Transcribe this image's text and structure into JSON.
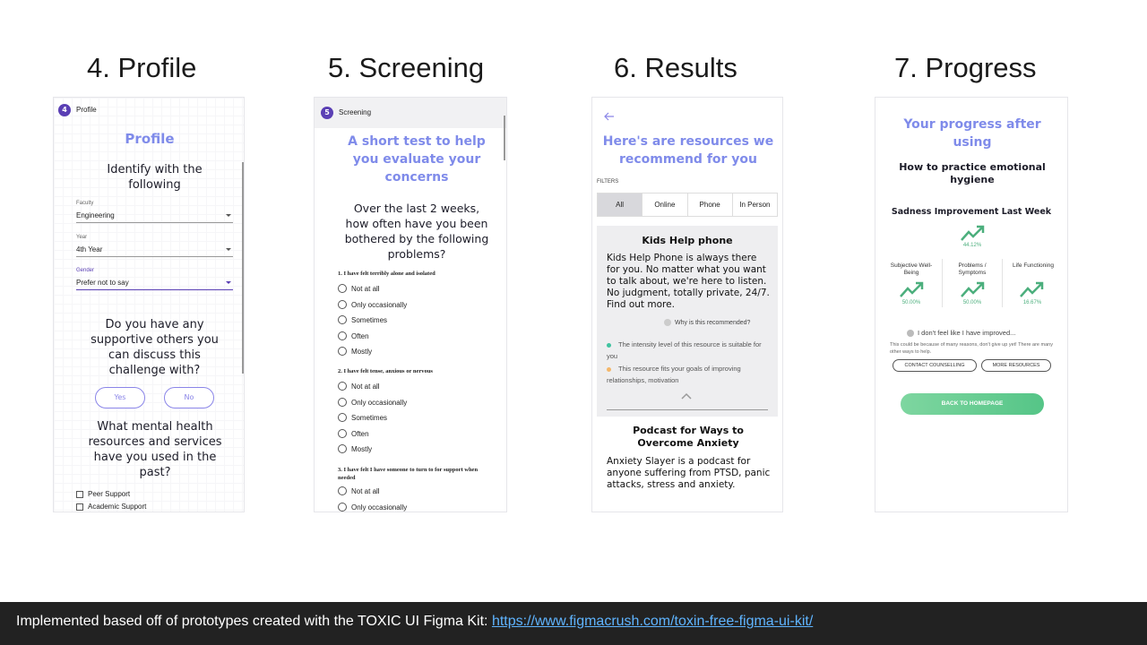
{
  "section_titles": [
    "4. Profile",
    "5. Screening",
    "6. Results",
    "7. Progress"
  ],
  "profile": {
    "step_number": "4",
    "step_label": "Profile",
    "heading": "Profile",
    "subheading": "Identify with the following",
    "fields": [
      {
        "label": "Faculty",
        "value": "Engineering"
      },
      {
        "label": "Year",
        "value": "4th Year"
      },
      {
        "label": "Gender",
        "value": "Prefer not to say"
      }
    ],
    "question1": "Do you have any supportive others you can discuss this challenge with?",
    "yes_label": "Yes",
    "no_label": "No",
    "question2": "What mental health resources and services have you used in the past?",
    "checkboxes": [
      "Peer Support",
      "Academic Support"
    ]
  },
  "screening": {
    "step_number": "5",
    "step_label": "Screening",
    "heading": "A short test to help you evaluate your concerns",
    "prompt": "Over the last 2 weeks, how often have you been bothered by the following problems?",
    "q1": "1. I have felt terribly alone and isolated",
    "q2": "2. I have felt tense, anxious or nervous",
    "q3": "3. I have felt I have someone to turn to for support when needed",
    "options": [
      "Not at all",
      "Only occasionally",
      "Sometimes",
      "Often",
      "Mostly"
    ]
  },
  "results": {
    "back_icon": "back-arrow-icon",
    "heading": "Here's are resources we recommend for you",
    "filters_label": "FILTERS",
    "filters": [
      "All",
      "Online",
      "Phone",
      "In Person"
    ],
    "active_filter": "All",
    "card1_title": "Kids Help phone",
    "card1_body": "Kids Help Phone is always there for you. No matter what you want to talk about, we're here to listen. No judgment, totally private, 24/7. Find out more.",
    "why_label": "Why is this recommended?",
    "reason1": "The intensity level of this resource is suitable for you",
    "reason2": "This resource fits your goals of improving relationships, motivation",
    "card2_title": "Podcast for Ways to Overcome Anxiety",
    "card2_body": "Anxiety Slayer is a podcast for anyone suffering from PTSD, panic attacks, stress and anxiety.",
    "colors": {
      "reason1": "#3fc3a0",
      "reason2": "#f4b76a"
    }
  },
  "progress": {
    "heading": "Your progress after using",
    "subheading": "How to practice emotional hygiene",
    "chart_title": "Sadness Improvement Last Week",
    "main_pct": "44.12%",
    "metrics": [
      {
        "label": "Subjective Well-Being",
        "pct": "50.00%"
      },
      {
        "label": "Problems / Symptoms",
        "pct": "50.00%"
      },
      {
        "label": "Life Functioning",
        "pct": "16.67%"
      }
    ],
    "not_improved": "I don't feel like I have improved...",
    "not_improved_note": "This could be because of many reasons, don't give up yet! There are many other ways to help.",
    "contact_label": "CONTACT COUNSELLING",
    "more_label": "MORE RESOURCES",
    "back_label": "BACK TO HOMEPAGE",
    "colors": {
      "trend": "#4caf7d"
    }
  },
  "footer": {
    "text": "Implemented based off of prototypes created with the TOXIC UI Figma Kit: ",
    "link": "https://www.figmacrush.com/toxin-free-figma-ui-kit/"
  }
}
